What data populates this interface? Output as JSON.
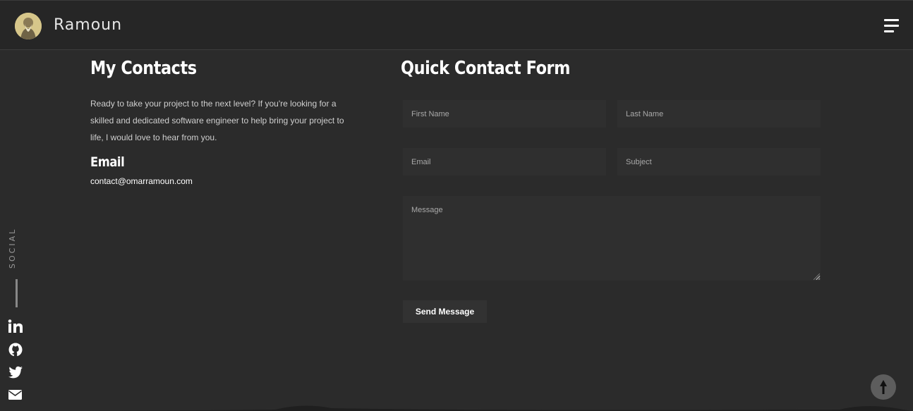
{
  "header": {
    "brand": "Ramoun",
    "avatar_icon": "portrait-avatar",
    "menu_icon": "hamburger-menu-icon"
  },
  "contacts": {
    "title": "My Contacts",
    "intro": "Ready to take your project to the next level? If you're looking for a skilled and dedicated software engineer to help bring your project to life, I would love to hear from you.",
    "email_heading": "Email",
    "email_value": "contact@omarramoun.com"
  },
  "form": {
    "title": "Quick Contact Form",
    "first_name_placeholder": "First Name",
    "last_name_placeholder": "Last Name",
    "email_placeholder": "Email",
    "subject_placeholder": "Subject",
    "message_placeholder": "Message",
    "send_label": "Send Message"
  },
  "social": {
    "label": "SOCIAL",
    "icons": [
      "linkedin-icon",
      "github-icon",
      "twitter-icon",
      "mail-icon"
    ]
  },
  "scroll_top_icon": "arrow-up-icon",
  "colors": {
    "background": "#2b2b2b",
    "topbar": "#262626",
    "field": "#2f2f2f",
    "text": "#ffffff"
  }
}
